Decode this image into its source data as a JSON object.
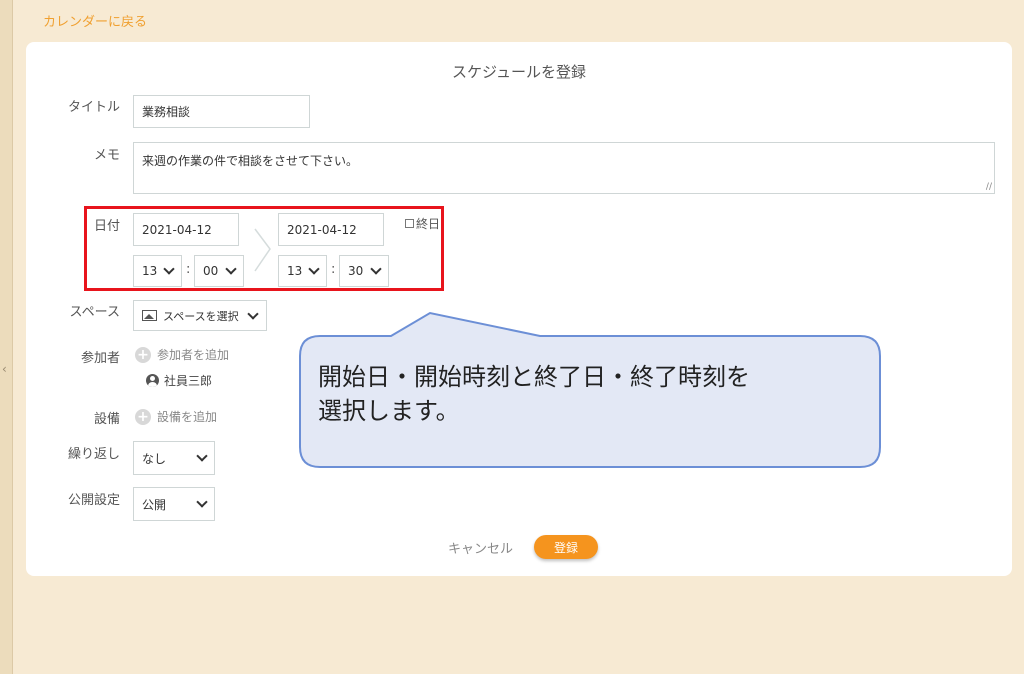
{
  "back_link": "カレンダーに戻る",
  "form": {
    "title": "スケジュールを登録",
    "labels": {
      "title": "タイトル",
      "memo": "メモ",
      "date": "日付",
      "space": "スペース",
      "participants": "参加者",
      "equipment": "設備",
      "repeat": "繰り返し",
      "visibility": "公開設定"
    },
    "title_value": "業務相談",
    "memo_value": "来週の作業の件で相談をさせて下さい。",
    "start": {
      "date": "2021-04-12",
      "hour": "13",
      "minute": "00"
    },
    "end": {
      "date": "2021-04-12",
      "hour": "13",
      "minute": "30"
    },
    "time_separator": ":",
    "allday_label": "終日",
    "space_select": "スペースを選択",
    "add_participant": "参加者を追加",
    "participant": "社員三郎",
    "add_equipment": "設備を追加",
    "repeat_value": "なし",
    "visibility_value": "公開",
    "cancel": "キャンセル",
    "submit": "登録"
  },
  "callout": {
    "line1": "開始日・開始時刻と終了日・終了時刻を",
    "line2": "選択します。"
  },
  "colors": {
    "accent": "#f5941e",
    "highlight": "#e8141c",
    "callout_fill": "#e3e8f5",
    "callout_border": "#6c8fd6",
    "background": "#f7ead3"
  }
}
